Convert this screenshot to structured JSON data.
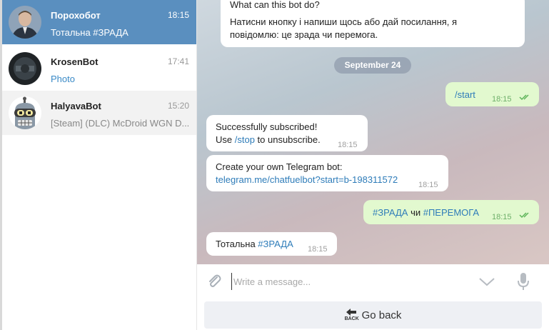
{
  "chats": [
    {
      "name": "Порохобот",
      "time": "18:15",
      "preview": "Тотальна #ЗРАДА"
    },
    {
      "name": "KrosenBot",
      "time": "17:41",
      "preview": "Photo"
    },
    {
      "name": "HalyavaBot",
      "time": "15:20",
      "preview": "[Steam] (DLC) McDroid WGN D..."
    }
  ],
  "messages": {
    "intro_title": "What can this bot do?",
    "intro_line1": "Натисни кнопку і напиши щось або дай посилання, я",
    "intro_line2": "повідомлю: це зрада чи перемога.",
    "date_separator": "September 24",
    "start_cmd": "/start",
    "start_time": "18:15",
    "subscribed_line1": "Successfully subscribed!",
    "subscribed_use": "Use ",
    "subscribed_stop": "/stop",
    "subscribed_rest": " to unsubscribe.",
    "subscribed_time": "18:15",
    "create_line1": "Create your own Telegram bot:",
    "create_link": "telegram.me/chatfuelbot?start=b-198311572",
    "create_time": "18:15",
    "choice_tag1": "#ЗРАДА",
    "choice_mid": " чи ",
    "choice_tag2": "#ПЕРЕМОГА",
    "choice_time": "18:15",
    "total_prefix": "Тотальна ",
    "total_tag": "#ЗРАДА",
    "total_time": "18:15"
  },
  "composer": {
    "placeholder": "Write a message..."
  },
  "keyboard": {
    "goback_label": "Go back",
    "back_icon_text": "BACK"
  },
  "colors": {
    "active_chat": "#5a8fbf",
    "outgoing_bubble": "#e2f9cf",
    "link": "#2e7cb9"
  }
}
